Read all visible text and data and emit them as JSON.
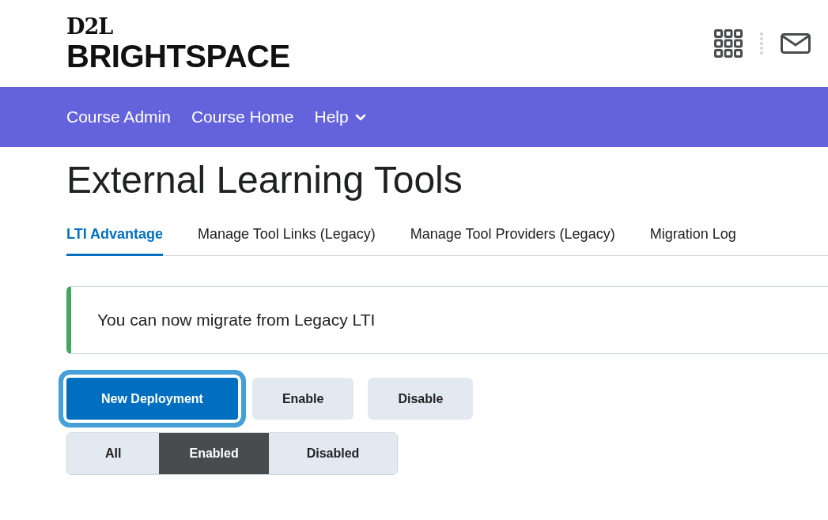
{
  "logo": {
    "top": "D2L",
    "bottom": "BRIGHTSPACE"
  },
  "nav": [
    {
      "label": "Course Admin",
      "has_menu": false
    },
    {
      "label": "Course Home",
      "has_menu": false
    },
    {
      "label": "Help",
      "has_menu": true
    }
  ],
  "page_title": "External Learning Tools",
  "tabs": [
    {
      "label": "LTI Advantage",
      "selected": true
    },
    {
      "label": "Manage Tool Links (Legacy)",
      "selected": false
    },
    {
      "label": "Manage Tool Providers (Legacy)",
      "selected": false
    },
    {
      "label": "Migration Log",
      "selected": false
    }
  ],
  "alert": {
    "text": "You can now migrate from Legacy LTI"
  },
  "actions": [
    {
      "label": "New Deployment",
      "kind": "primary",
      "focused": true
    },
    {
      "label": "Enable",
      "kind": "secondary",
      "focused": false
    },
    {
      "label": "Disable",
      "kind": "secondary",
      "focused": false
    }
  ],
  "filters": [
    {
      "label": "All",
      "selected": false
    },
    {
      "label": "Enabled",
      "selected": true
    },
    {
      "label": "Disabled",
      "selected": false
    }
  ]
}
